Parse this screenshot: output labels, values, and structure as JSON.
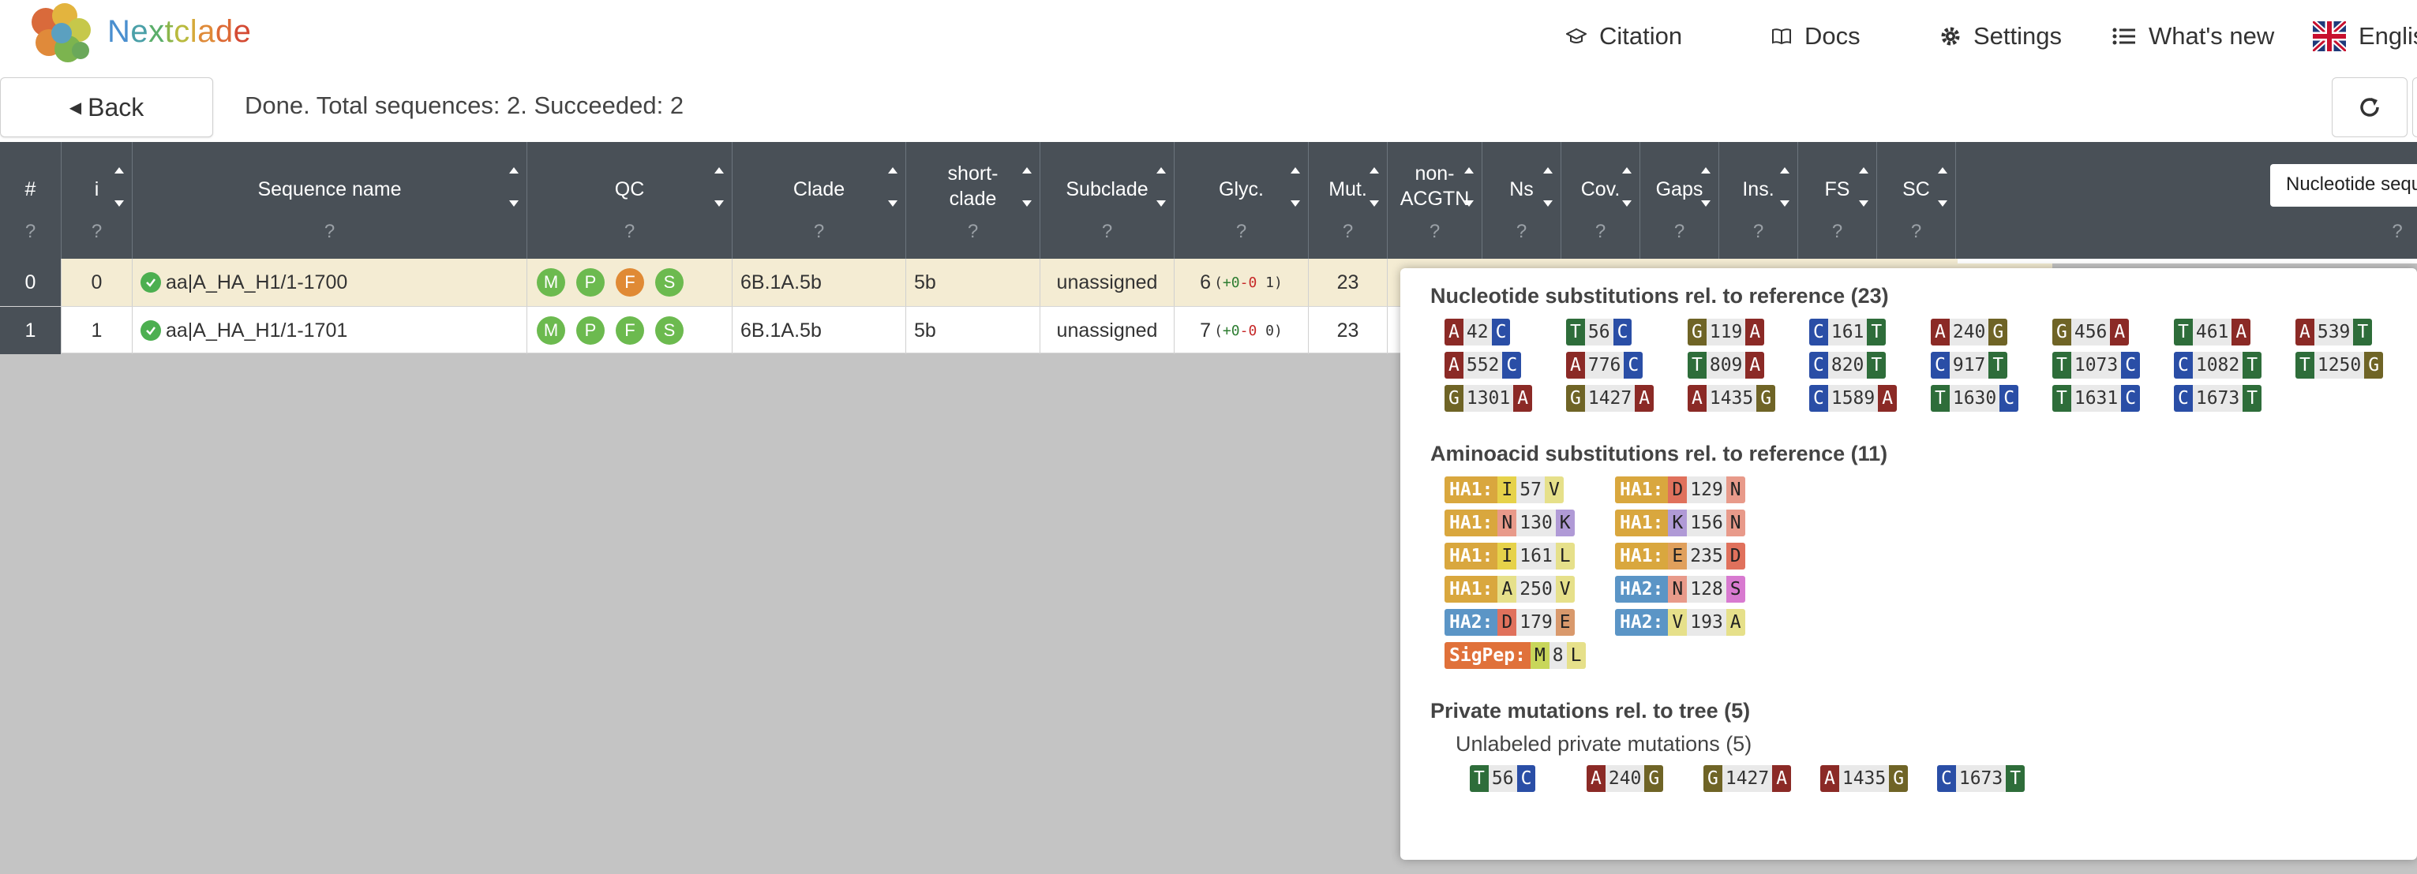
{
  "colors": {
    "A": "#8b2a26",
    "C": "#2a4ea6",
    "G": "#6f6426",
    "T": "#2e6d3a",
    "gene_HA1": "#d9a73e",
    "gene_HA2": "#5b95c6",
    "gene_SigPep": "#e0713a",
    "qc_good": "#6cba4f",
    "qc_mediocre": "#e08a35"
  },
  "nav": {
    "brand": "Nextclade",
    "citation": "Citation",
    "docs": "Docs",
    "settings": "Settings",
    "whats_new": "What's new",
    "language": "English"
  },
  "toolbar": {
    "back": "Back",
    "status": "Done. Total sequences: 2. Succeeded: 2"
  },
  "table": {
    "headers": {
      "index": "#",
      "i": "i",
      "seqname": "Sequence name",
      "qc": "QC",
      "clade": "Clade",
      "shortclade_1": "short-",
      "shortclade_2": "clade",
      "subclade": "Subclade",
      "glyc": "Glyc.",
      "mut": "Mut.",
      "nonacgtn_1": "non-",
      "nonacgtn_2": "ACGTN",
      "ns": "Ns",
      "cov": "Cov.",
      "gaps": "Gaps",
      "ins": "Ins.",
      "fs": "FS",
      "sc": "SC",
      "help": "?",
      "seqview": "Nucleotide sequence"
    },
    "rows": [
      {
        "index": "0",
        "i": "0",
        "name": "aa|A_HA_H1/1-1700",
        "qc": [
          "M",
          "P",
          "F",
          "S"
        ],
        "qc_status": [
          "good",
          "good",
          "mediocre",
          "good"
        ],
        "clade": "6B.1A.5b",
        "shortclade": "5b",
        "subclade": "unassigned",
        "glyc_count": "6",
        "glyc_open": "(",
        "glyc_plus": "+0",
        "glyc_minus": "-0",
        "glyc_rest": " 1)",
        "mut": "23"
      },
      {
        "index": "1",
        "i": "1",
        "name": "aa|A_HA_H1/1-1701",
        "qc": [
          "M",
          "P",
          "F",
          "S"
        ],
        "qc_status": [
          "good",
          "good",
          "good",
          "good"
        ],
        "clade": "6B.1A.5b",
        "shortclade": "5b",
        "subclade": "unassigned",
        "glyc_count": "7",
        "glyc_open": "(",
        "glyc_plus": "+0",
        "glyc_minus": "-0",
        "glyc_rest": " 0)",
        "mut": "23"
      }
    ]
  },
  "tooltip": {
    "nuc_title": "Nucleotide substitutions rel. to reference (23)",
    "nuc": [
      {
        "ref": "A",
        "pos": "42",
        "qry": "C"
      },
      {
        "ref": "T",
        "pos": "56",
        "qry": "C"
      },
      {
        "ref": "G",
        "pos": "119",
        "qry": "A"
      },
      {
        "ref": "C",
        "pos": "161",
        "qry": "T"
      },
      {
        "ref": "A",
        "pos": "240",
        "qry": "G"
      },
      {
        "ref": "G",
        "pos": "456",
        "qry": "A"
      },
      {
        "ref": "T",
        "pos": "461",
        "qry": "A"
      },
      {
        "ref": "A",
        "pos": "539",
        "qry": "T"
      },
      {
        "ref": "A",
        "pos": "552",
        "qry": "C"
      },
      {
        "ref": "A",
        "pos": "776",
        "qry": "C"
      },
      {
        "ref": "T",
        "pos": "809",
        "qry": "A"
      },
      {
        "ref": "C",
        "pos": "820",
        "qry": "T"
      },
      {
        "ref": "C",
        "pos": "917",
        "qry": "T"
      },
      {
        "ref": "T",
        "pos": "1073",
        "qry": "C"
      },
      {
        "ref": "C",
        "pos": "1082",
        "qry": "T"
      },
      {
        "ref": "T",
        "pos": "1250",
        "qry": "G"
      },
      {
        "ref": "G",
        "pos": "1301",
        "qry": "A"
      },
      {
        "ref": "G",
        "pos": "1427",
        "qry": "A"
      },
      {
        "ref": "A",
        "pos": "1435",
        "qry": "G"
      },
      {
        "ref": "C",
        "pos": "1589",
        "qry": "A"
      },
      {
        "ref": "T",
        "pos": "1630",
        "qry": "C"
      },
      {
        "ref": "T",
        "pos": "1631",
        "qry": "C"
      },
      {
        "ref": "C",
        "pos": "1673",
        "qry": "T"
      }
    ],
    "aa_title": "Aminoacid substitutions rel. to reference (11)",
    "aa": [
      {
        "gene": "HA1",
        "ref": "I",
        "pos": "57",
        "qry": "V",
        "rc": "#e6d24a",
        "qc": "#e6e08a"
      },
      {
        "gene": "HA1",
        "ref": "D",
        "pos": "129",
        "qry": "N",
        "rc": "#e0715c",
        "qc": "#e89a8a"
      },
      {
        "gene": "HA1",
        "ref": "N",
        "pos": "130",
        "qry": "K",
        "rc": "#e89a8a",
        "qc": "#b09ad6"
      },
      {
        "gene": "HA1",
        "ref": "K",
        "pos": "156",
        "qry": "N",
        "rc": "#b09ad6",
        "qc": "#e89a8a"
      },
      {
        "gene": "HA1",
        "ref": "I",
        "pos": "161",
        "qry": "L",
        "rc": "#e6d24a",
        "qc": "#e6e08a"
      },
      {
        "gene": "HA1",
        "ref": "E",
        "pos": "235",
        "qry": "D",
        "rc": "#e0a05c",
        "qc": "#e0715c"
      },
      {
        "gene": "HA1",
        "ref": "A",
        "pos": "250",
        "qry": "V",
        "rc": "#e6e08a",
        "qc": "#e6e08a"
      },
      {
        "gene": "HA2",
        "ref": "N",
        "pos": "128",
        "qry": "S",
        "rc": "#e89a8a",
        "qc": "#d87ad0"
      },
      {
        "gene": "HA2",
        "ref": "D",
        "pos": "179",
        "qry": "E",
        "rc": "#e0715c",
        "qc": "#d9996c"
      },
      {
        "gene": "HA2",
        "ref": "V",
        "pos": "193",
        "qry": "A",
        "rc": "#e6e08a",
        "qc": "#e6e08a"
      },
      {
        "gene": "SigPep",
        "ref": "M",
        "pos": "8",
        "qry": "L",
        "rc": "#c8d65a",
        "qc": "#e6e08a"
      }
    ],
    "priv_title": "Private mutations rel. to tree (5)",
    "priv_sub": "Unlabeled private mutations (5)",
    "priv": [
      {
        "ref": "T",
        "pos": "56",
        "qry": "C"
      },
      {
        "ref": "A",
        "pos": "240",
        "qry": "G"
      },
      {
        "ref": "G",
        "pos": "1427",
        "qry": "A"
      },
      {
        "ref": "A",
        "pos": "1435",
        "qry": "G"
      },
      {
        "ref": "C",
        "pos": "1673",
        "qry": "T"
      }
    ]
  }
}
